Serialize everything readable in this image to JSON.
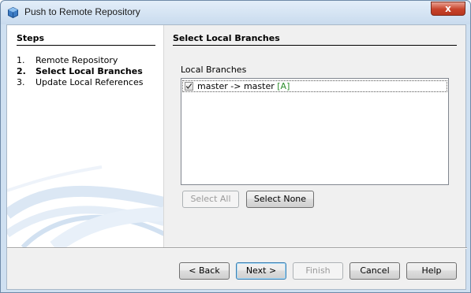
{
  "window": {
    "title": "Push to Remote Repository",
    "close_glyph": "x"
  },
  "steps": {
    "title": "Steps",
    "items": [
      {
        "num": "1.",
        "label": "Remote Repository"
      },
      {
        "num": "2.",
        "label": "Select Local Branches"
      },
      {
        "num": "3.",
        "label": "Update Local References"
      }
    ],
    "current_index": 1
  },
  "content": {
    "title": "Select Local Branches",
    "branches_label": "Local Branches",
    "branches": [
      {
        "text": "master -> master",
        "tag": "[A]",
        "checked": true
      }
    ],
    "select_all_label": "Select All",
    "select_none_label": "Select None"
  },
  "buttons": {
    "back": "< Back",
    "next": "Next >",
    "finish": "Finish",
    "cancel": "Cancel",
    "help": "Help"
  },
  "icons": {
    "title_icon": "netbeans-cube-icon",
    "checkbox": "checkmark-icon"
  },
  "colors": {
    "titlebar": "#c9dbee",
    "close_button": "#c7432a",
    "branch_tag": "#2a8c2a"
  }
}
